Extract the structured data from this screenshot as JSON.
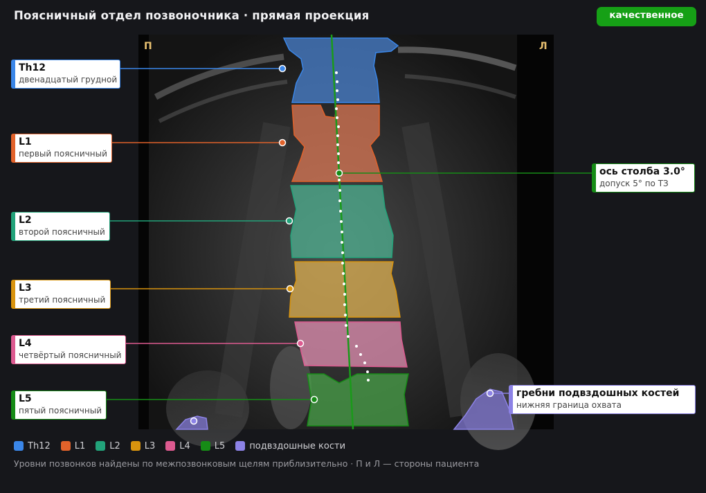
{
  "header": {
    "title": "Поясничный отдел позвоночника · прямая проекция",
    "badge": "качественное"
  },
  "scan": {
    "side_right_patient": "П",
    "side_left_patient": "Л"
  },
  "colors": {
    "Th12": "#3a86e8",
    "L1": "#e2622a",
    "L2": "#22a37a",
    "L3": "#d9940e",
    "L4": "#dd5a90",
    "L5": "#168c16",
    "iliac": "#8c82e6"
  },
  "callouts": {
    "th12": {
      "name": "Th12",
      "subtitle": "двенадцатый грудной"
    },
    "l1": {
      "name": "L1",
      "subtitle": "первый поясничный"
    },
    "l2": {
      "name": "L2",
      "subtitle": "второй поясничный"
    },
    "l3": {
      "name": "L3",
      "subtitle": "третий поясничный"
    },
    "l4": {
      "name": "L4",
      "subtitle": "четвёртый поясничный"
    },
    "l5": {
      "name": "L5",
      "subtitle": "пятый поясничный"
    },
    "axis": {
      "name": "ось столба 3.0°",
      "subtitle": "допуск 5° по ТЗ"
    },
    "iliac": {
      "name": "гребни подвздошных костей",
      "subtitle": "нижняя граница охвата"
    }
  },
  "legend": [
    {
      "label": "Th12"
    },
    {
      "label": "L1"
    },
    {
      "label": "L2"
    },
    {
      "label": "L3"
    },
    {
      "label": "L4"
    },
    {
      "label": "L5"
    },
    {
      "label": "подвздошные кости"
    }
  ],
  "footnote": "Уровни позвонков найдены по межпозвонковым щелям приблизительно · П и Л — стороны пациента"
}
